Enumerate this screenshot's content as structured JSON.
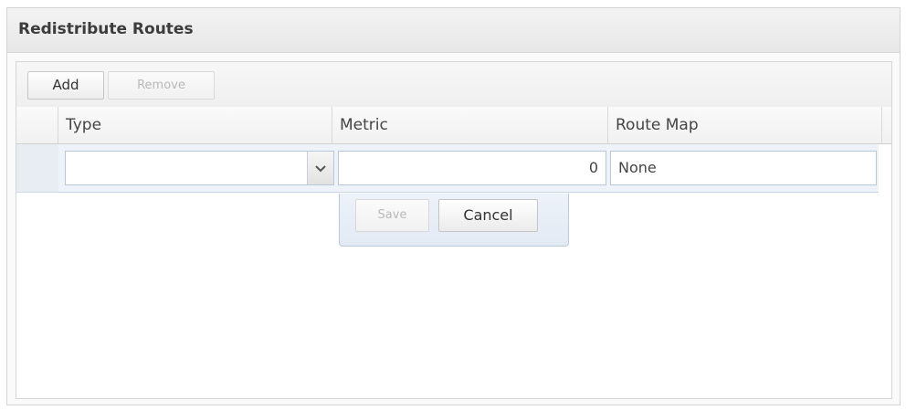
{
  "panel": {
    "title": "Redistribute Routes"
  },
  "toolbar": {
    "add_label": "Add",
    "remove_label": "Remove"
  },
  "grid": {
    "columns": [
      "Type",
      "Metric",
      "Route Map"
    ]
  },
  "editor": {
    "type_value": "",
    "metric_value": "0",
    "route_map_value": "None",
    "save_label": "Save",
    "cancel_label": "Cancel"
  },
  "icons": {
    "type_dropdown": "chevron-down-icon"
  }
}
